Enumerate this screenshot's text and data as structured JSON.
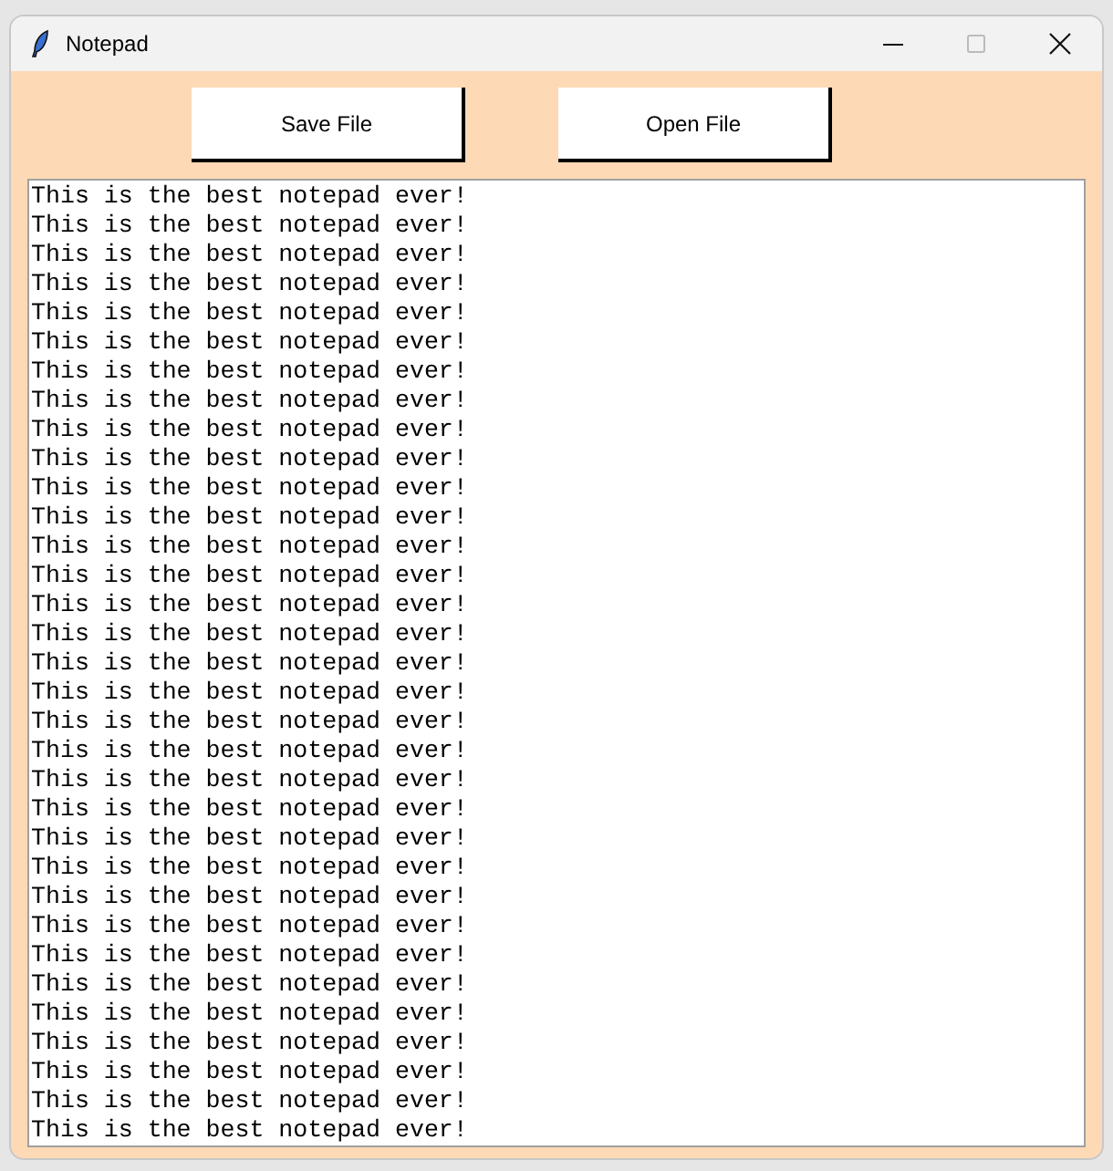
{
  "window": {
    "title": "Notepad"
  },
  "buttons": [
    "Save File",
    "Open File"
  ],
  "editor": {
    "lines": [
      "This is the best notepad ever!",
      "This is the best notepad ever!",
      "This is the best notepad ever!",
      "This is the best notepad ever!",
      "This is the best notepad ever!",
      "This is the best notepad ever!",
      "This is the best notepad ever!",
      "This is the best notepad ever!",
      "This is the best notepad ever!",
      "This is the best notepad ever!",
      "This is the best notepad ever!",
      "This is the best notepad ever!",
      "This is the best notepad ever!",
      "This is the best notepad ever!",
      "This is the best notepad ever!",
      "This is the best notepad ever!",
      "This is the best notepad ever!",
      "This is the best notepad ever!",
      "This is the best notepad ever!",
      "This is the best notepad ever!",
      "This is the best notepad ever!",
      "This is the best notepad ever!",
      "This is the best notepad ever!",
      "This is the best notepad ever!",
      "This is the best notepad ever!",
      "This is the best notepad ever!",
      "This is the best notepad ever!",
      "This is the best notepad ever!",
      "This is the best notepad ever!",
      "This is the best notepad ever!",
      "This is the best notepad ever!",
      "This is the best notepad ever!",
      "This is the best notepad ever!"
    ]
  }
}
